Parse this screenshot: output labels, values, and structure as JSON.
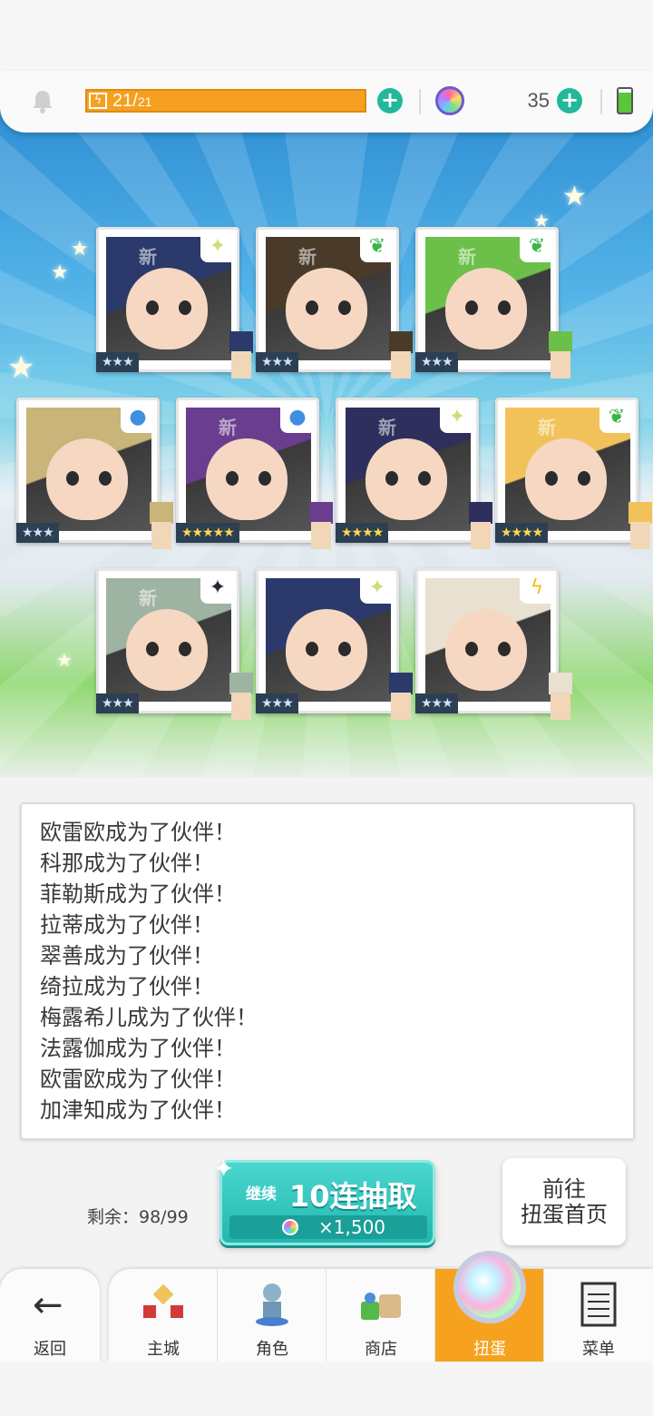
{
  "resources": {
    "stamina_current": "21",
    "stamina_separator": "/",
    "stamina_max": "21",
    "stamina_fraction": 1.0,
    "gem_count": "35"
  },
  "cards": [
    {
      "new_tag": "新",
      "stars": "★★★",
      "rarity": 3,
      "badge_icon": "sparkle-icon",
      "color": "#2b3a6b"
    },
    {
      "new_tag": "新",
      "stars": "★★★",
      "rarity": 3,
      "badge_icon": "leaf-icon",
      "color": "#4a3a2a"
    },
    {
      "new_tag": "新",
      "stars": "★★★",
      "rarity": 3,
      "badge_icon": "leaf-icon",
      "color": "#6cc04a"
    },
    {
      "new_tag": "",
      "stars": "★★★",
      "rarity": 3,
      "badge_icon": "water-icon",
      "color": "#c9b47a"
    },
    {
      "new_tag": "新",
      "stars": "★★★★★",
      "rarity": 5,
      "badge_icon": "water-icon",
      "color": "#6a3d8f"
    },
    {
      "new_tag": "新",
      "stars": "★★★★",
      "rarity": 4,
      "badge_icon": "sparkle-icon",
      "color": "#2e2f5c"
    },
    {
      "new_tag": "新",
      "stars": "★★★★",
      "rarity": 4,
      "badge_icon": "leaf-icon",
      "color": "#f2c25a"
    },
    {
      "new_tag": "新",
      "stars": "★★★",
      "rarity": 3,
      "badge_icon": "dark-icon",
      "color": "#9fb3a3"
    },
    {
      "new_tag": "",
      "stars": "★★★",
      "rarity": 3,
      "badge_icon": "sparkle-icon",
      "color": "#2b3a6b"
    },
    {
      "new_tag": "",
      "stars": "★★★",
      "rarity": 3,
      "badge_icon": "thunder-icon",
      "color": "#e8e0d0"
    }
  ],
  "messages": [
    "欧雷欧成为了伙伴！",
    "科那成为了伙伴！",
    "菲勒斯成为了伙伴！",
    "拉蒂成为了伙伴！",
    "翠善成为了伙伴！",
    "绮拉成为了伙伴！",
    "梅露希儿成为了伙伴！",
    "法露伽成为了伙伴！",
    "欧雷欧成为了伙伴！",
    "加津知成为了伙伴！"
  ],
  "gacha": {
    "remaining": "剩余：98/99",
    "continue_label": "继续",
    "pull_label": "10连抽取",
    "cost": "×1,500",
    "home_line1": "前往",
    "home_line2": "扭蛋首页"
  },
  "nav": {
    "back": "返回",
    "tabs": [
      {
        "label": "主城",
        "icon": "castle-icon"
      },
      {
        "label": "角色",
        "icon": "character-icon"
      },
      {
        "label": "商店",
        "icon": "shop-icon"
      },
      {
        "label": "扭蛋",
        "icon": "gacha-icon",
        "active": true
      },
      {
        "label": "菜单",
        "icon": "menu-icon"
      }
    ]
  },
  "colors": {
    "accent_orange": "#f7a21e",
    "teal": "#22b7b0",
    "plus_green": "#22b89a"
  }
}
